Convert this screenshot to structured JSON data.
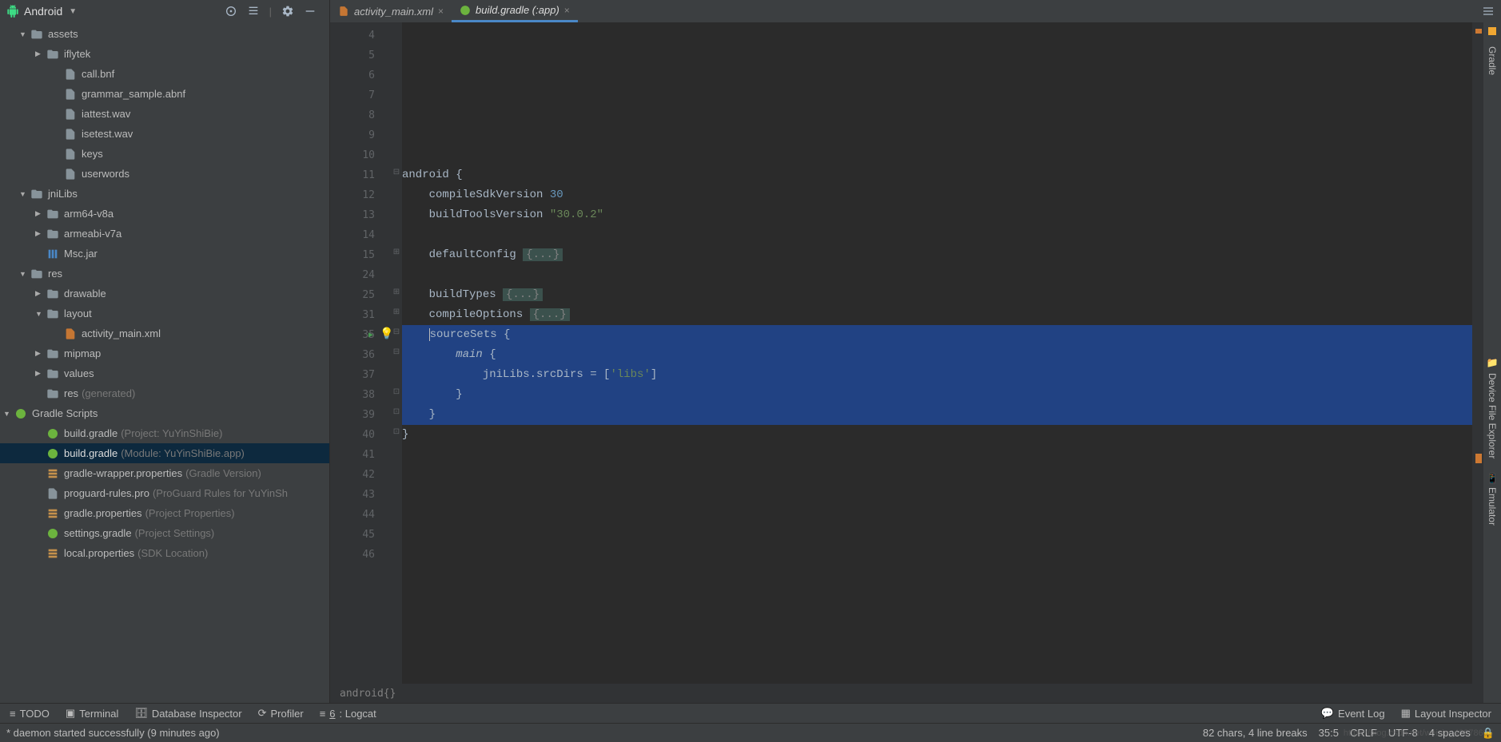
{
  "header": {
    "project_view": "Android"
  },
  "tabs": [
    {
      "label": "activity_main.xml",
      "active": false
    },
    {
      "label": "build.gradle (:app)",
      "active": true
    }
  ],
  "tree": {
    "items": [
      {
        "indent": 24,
        "arrow": "▼",
        "icon": "folder",
        "label": "assets"
      },
      {
        "indent": 44,
        "arrow": "▶",
        "icon": "folder",
        "label": "iflytek"
      },
      {
        "indent": 66,
        "arrow": "",
        "icon": "file",
        "label": "call.bnf"
      },
      {
        "indent": 66,
        "arrow": "",
        "icon": "file",
        "label": "grammar_sample.abnf"
      },
      {
        "indent": 66,
        "arrow": "",
        "icon": "file",
        "label": "iattest.wav"
      },
      {
        "indent": 66,
        "arrow": "",
        "icon": "file",
        "label": "isetest.wav"
      },
      {
        "indent": 66,
        "arrow": "",
        "icon": "file",
        "label": "keys"
      },
      {
        "indent": 66,
        "arrow": "",
        "icon": "file",
        "label": "userwords"
      },
      {
        "indent": 24,
        "arrow": "▼",
        "icon": "folder",
        "label": "jniLibs"
      },
      {
        "indent": 44,
        "arrow": "▶",
        "icon": "folder",
        "label": "arm64-v8a"
      },
      {
        "indent": 44,
        "arrow": "▶",
        "icon": "folder",
        "label": "armeabi-v7a"
      },
      {
        "indent": 44,
        "arrow": "",
        "icon": "jar",
        "label": "Msc.jar"
      },
      {
        "indent": 24,
        "arrow": "▼",
        "icon": "folder",
        "label": "res"
      },
      {
        "indent": 44,
        "arrow": "▶",
        "icon": "folder",
        "label": "drawable"
      },
      {
        "indent": 44,
        "arrow": "▼",
        "icon": "folder",
        "label": "layout"
      },
      {
        "indent": 66,
        "arrow": "",
        "icon": "xml",
        "label": "activity_main.xml"
      },
      {
        "indent": 44,
        "arrow": "▶",
        "icon": "folder",
        "label": "mipmap"
      },
      {
        "indent": 44,
        "arrow": "▶",
        "icon": "folder",
        "label": "values"
      },
      {
        "indent": 44,
        "arrow": "",
        "icon": "folder",
        "label": "res",
        "hint": "(generated)"
      },
      {
        "indent": 4,
        "arrow": "▼",
        "icon": "gradle",
        "label": "Gradle Scripts"
      },
      {
        "indent": 44,
        "arrow": "",
        "icon": "gradle",
        "label": "build.gradle",
        "hint": "(Project: YuYinShiBie)"
      },
      {
        "indent": 44,
        "arrow": "",
        "icon": "gradle",
        "label": "build.gradle",
        "hint": "(Module: YuYinShiBie.app)",
        "selected": true
      },
      {
        "indent": 44,
        "arrow": "",
        "icon": "prop",
        "label": "gradle-wrapper.properties",
        "hint": "(Gradle Version)"
      },
      {
        "indent": 44,
        "arrow": "",
        "icon": "file",
        "label": "proguard-rules.pro",
        "hint": "(ProGuard Rules for YuYinSh"
      },
      {
        "indent": 44,
        "arrow": "",
        "icon": "prop",
        "label": "gradle.properties",
        "hint": "(Project Properties)"
      },
      {
        "indent": 44,
        "arrow": "",
        "icon": "gradle",
        "label": "settings.gradle",
        "hint": "(Project Settings)"
      },
      {
        "indent": 44,
        "arrow": "",
        "icon": "prop",
        "label": "local.properties",
        "hint": "(SDK Location)"
      }
    ]
  },
  "editor": {
    "line_numbers": [
      "4",
      "5",
      "6",
      "7",
      "8",
      "9",
      "10",
      "11",
      "12",
      "13",
      "14",
      "15",
      "24",
      "25",
      "31",
      "35",
      "36",
      "37",
      "38",
      "39",
      "40",
      "41",
      "42",
      "43",
      "44",
      "45",
      "46"
    ],
    "code": {
      "android_open": "android {",
      "compileSdk_k": "    compileSdkVersion ",
      "compileSdk_v": "30",
      "buildTools_k": "    buildToolsVersion ",
      "buildTools_v": "\"30.0.2\"",
      "defaultConfig": "    defaultConfig ",
      "fold": "{...}",
      "buildTypes": "    buildTypes ",
      "compileOptions": "    compileOptions ",
      "sourceSets": "    sourceSets {",
      "main_open": "        main {",
      "jniLibs": "            jniLibs.srcDirs = [",
      "libs_str": "'libs'",
      "jniLibs_end": "]",
      "brace8": "        }",
      "brace4": "    }",
      "brace0": "}",
      "main_word": "main"
    },
    "breadcrumb": "android{}"
  },
  "rail": {
    "gradle": "Gradle",
    "dfe": "Device File Explorer",
    "emulator": "Emulator"
  },
  "tools": {
    "todo": "TODO",
    "terminal": "Terminal",
    "db": "Database Inspector",
    "profiler": "Profiler",
    "logcat_pre": "6",
    "logcat": ": Logcat",
    "eventlog": "Event Log",
    "layoutinsp": "Layout Inspector"
  },
  "status": {
    "left": "* daemon started successfully (9 minutes ago)",
    "chars": "82 chars, 4 line breaks",
    "pos": "35:5",
    "crlf": "CRLF",
    "enc": "UTF-8",
    "indent": "4 spaces",
    "watermark": "https://blog.csdn.net/weixin_43878605"
  }
}
